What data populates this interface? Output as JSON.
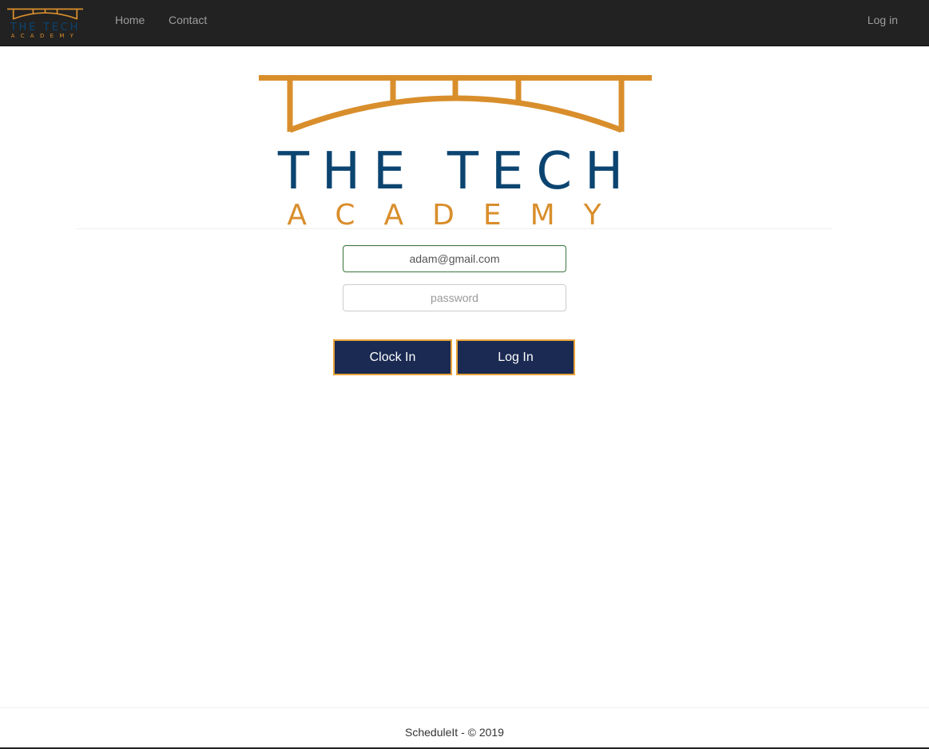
{
  "brand": {
    "logo_line1": "THE TECH",
    "logo_line2": "ACADEMY",
    "color_gold": "#d98e2c",
    "color_navy": "#0b4470"
  },
  "navbar": {
    "links": [
      {
        "label": "Home"
      },
      {
        "label": "Contact"
      }
    ],
    "login_label": "Log in"
  },
  "login_form": {
    "email_value": "adam@gmail.com",
    "password_placeholder": "password",
    "clock_in_label": "Clock In",
    "log_in_label": "Log In"
  },
  "footer": {
    "text": "ScheduleIt - © 2019"
  }
}
